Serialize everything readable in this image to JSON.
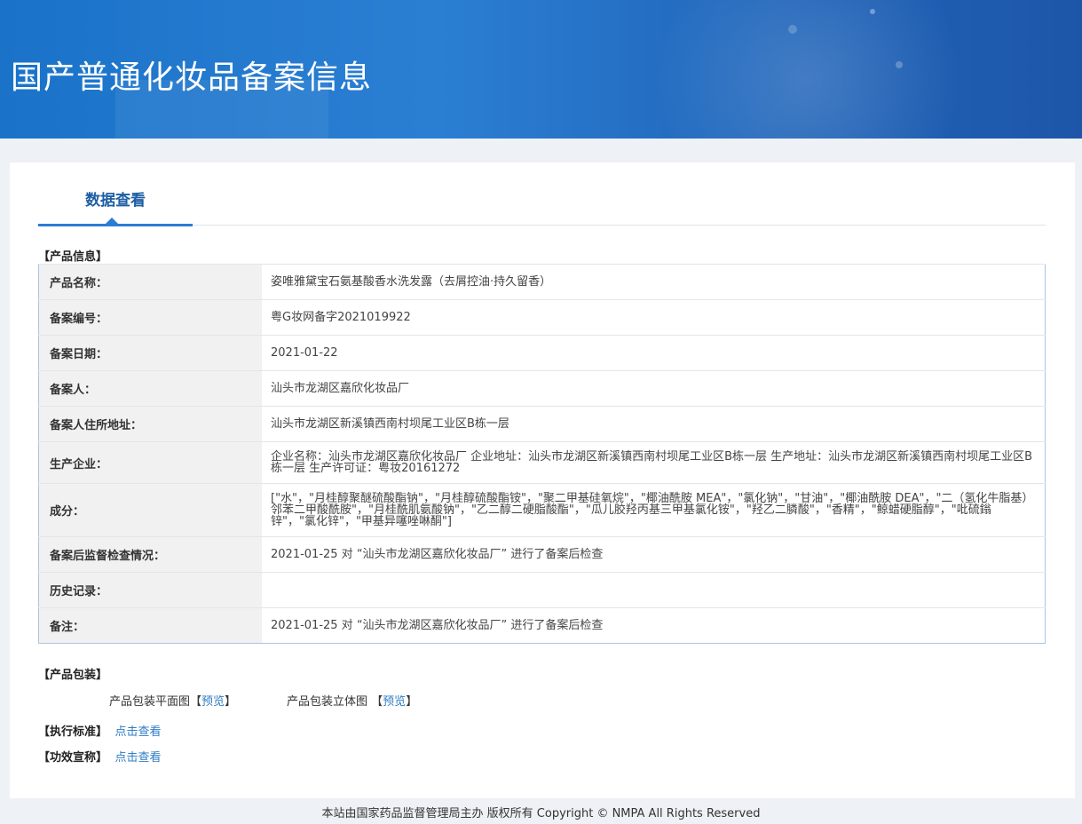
{
  "header": {
    "title": "国产普通化妆品备案信息"
  },
  "tab": {
    "label": "数据查看"
  },
  "sections": {
    "product_info": "【产品信息】",
    "packaging": "【产品包装】",
    "standard": "【执行标准】",
    "efficacy": "【功效宣称】"
  },
  "rows": [
    {
      "label": "产品名称：",
      "value": "姿唯雅黛宝石氨基酸香水洗发露（去屑控油·持久留香）"
    },
    {
      "label": "备案编号：",
      "value": "粤G妆网备字2021019922"
    },
    {
      "label": "备案日期：",
      "value": "2021-01-22"
    },
    {
      "label": "备案人：",
      "value": "汕头市龙湖区嘉欣化妆品厂"
    },
    {
      "label": "备案人住所地址：",
      "value": "汕头市龙湖区新溪镇西南村坝尾工业区B栋一层"
    },
    {
      "label": "生产企业：",
      "value": "企业名称：汕头市龙湖区嘉欣化妆品厂 企业地址：汕头市龙湖区新溪镇西南村坝尾工业区B栋一层 生产地址：汕头市龙湖区新溪镇西南村坝尾工业区B栋一层 生产许可证：粤妆20161272"
    },
    {
      "label": "成分：",
      "value": "[\"水\"，\"月桂醇聚醚硫酸酯钠\"，\"月桂醇硫酸酯铵\"，\"聚二甲基硅氧烷\"，\"椰油酰胺 MEA\"，\"氯化钠\"，\"甘油\"，\"椰油酰胺 DEA\"，\"二（氢化牛脂基）邻苯二甲酸酰胺\"，\"月桂酰肌氨酸钠\"，\"乙二醇二硬脂酸酯\"，\"瓜儿胶羟丙基三甲基氯化铵\"，\"羟乙二膦酸\"，\"香精\"，\"鲸蜡硬脂醇\"，\"吡硫鎓锌\"，\"氯化锌\"，\"甲基异噻唑啉酮\"]"
    },
    {
      "label": "备案后监督检查情况：",
      "value": "2021-01-25 对 “汕头市龙湖区嘉欣化妆品厂” 进行了备案后检查"
    },
    {
      "label": "历史记录：",
      "value": ""
    },
    {
      "label": "备注：",
      "value": "2021-01-25 对 “汕头市龙湖区嘉欣化妆品厂” 进行了备案后检查"
    }
  ],
  "packaging": {
    "flat_label": "产品包装平面图",
    "solid_label": "产品包装立体图",
    "bracket_open": "【",
    "bracket_close": "】",
    "preview": "预览"
  },
  "links": {
    "view": "点击查看"
  },
  "footer": {
    "text": "本站由国家药品监督管理局主办 版权所有 Copyright © NMPA All Rights Reserved"
  }
}
